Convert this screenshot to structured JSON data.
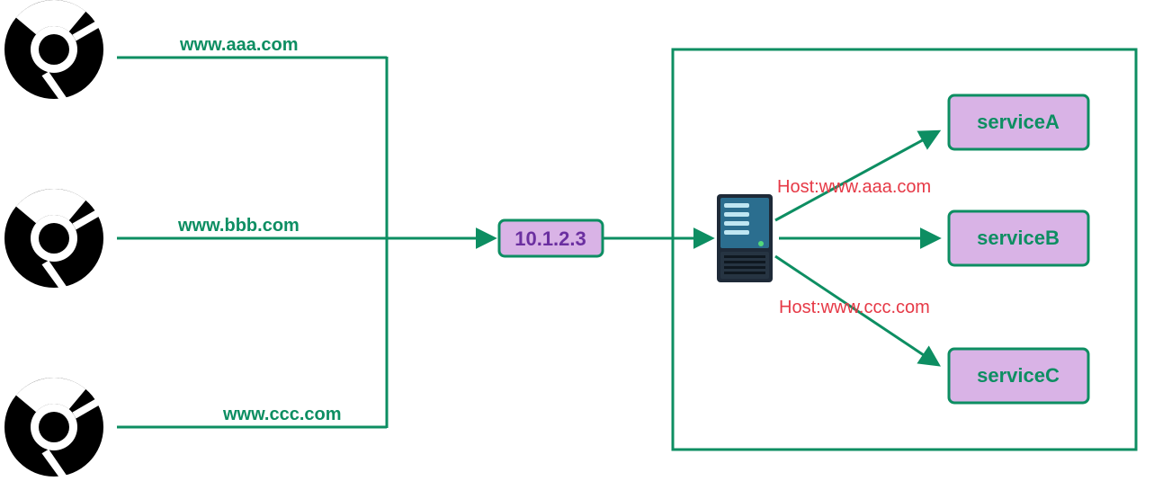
{
  "clients": [
    {
      "domain": "www.aaa.com"
    },
    {
      "domain": "www.bbb.com"
    },
    {
      "domain": "www.ccc.com"
    }
  ],
  "ingress_ip": "10.1.2.3",
  "host_routes": {
    "top": "Host:www.aaa.com",
    "bottom": "Host:www.ccc.com"
  },
  "services": {
    "a": "serviceA",
    "b": "serviceB",
    "c": "serviceC"
  },
  "colors": {
    "accent": "#0d8e62",
    "box_fill": "#d9b3e6",
    "box_text": "#6b2fa0",
    "annotation": "#e63946"
  }
}
